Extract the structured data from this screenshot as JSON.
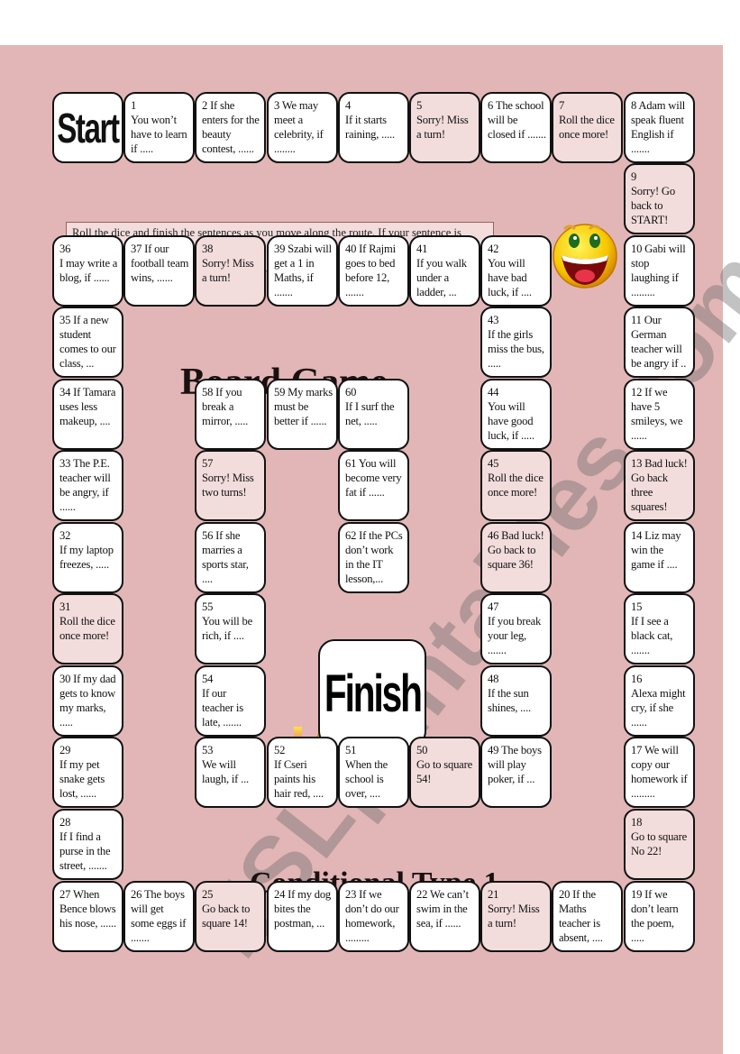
{
  "titles": {
    "board_game": "Board Game",
    "conditional": "Conditional Type 1"
  },
  "instructions": "Roll the dice and finish the sentences as you move along the route. If your sentence is incorrect, you can’t go forward. If you don’t even have a try to finish it, you must miss a turn.",
  "start_label": "Start",
  "finish_label": "Finish",
  "watermark": "ESLprintables.com",
  "colors": {
    "board_background": "#e2b6b6",
    "square_white": "#ffffff",
    "square_pink": "#f2dcdc",
    "border": "#111111"
  },
  "squares": [
    {
      "n": "1",
      "text": "You won’t have to learn if .....",
      "pink": false,
      "num_inline": false
    },
    {
      "n": "2",
      "text": "If she enters for the beauty contest, ......",
      "pink": false,
      "num_inline": true
    },
    {
      "n": "3",
      "text": "We may meet a celebrity, if ........",
      "pink": false,
      "num_inline": true
    },
    {
      "n": "4",
      "text": "If it starts raining, .....",
      "pink": false,
      "num_inline": false
    },
    {
      "n": "5",
      "text": "Sorry! Miss a turn!",
      "pink": true,
      "num_inline": false
    },
    {
      "n": "6",
      "text": "The school will be closed if .......",
      "pink": false,
      "num_inline": true
    },
    {
      "n": "7",
      "text": "Roll the dice once more!",
      "pink": true,
      "num_inline": false
    },
    {
      "n": "8",
      "text": "Adam will speak fluent English if .......",
      "pink": false,
      "num_inline": true
    },
    {
      "n": "9",
      "text": "Sorry! Go back to START!",
      "pink": true,
      "num_inline": false
    },
    {
      "n": "10",
      "text": "Gabi will stop laughing if .........",
      "pink": false,
      "num_inline": true
    },
    {
      "n": "11",
      "text": "Our German teacher will be angry if ..",
      "pink": false,
      "num_inline": true
    },
    {
      "n": "12",
      "text": "If we have 5 smileys, we ......",
      "pink": false,
      "num_inline": true
    },
    {
      "n": "13",
      "text": "Bad luck! Go back three squares!",
      "pink": true,
      "num_inline": true
    },
    {
      "n": "14",
      "text": "Liz may win the game if ....",
      "pink": false,
      "num_inline": true
    },
    {
      "n": "15",
      "text": "If I see a black cat, .......",
      "pink": false,
      "num_inline": false
    },
    {
      "n": "16",
      "text": "Alexa might cry, if she ......",
      "pink": false,
      "num_inline": false
    },
    {
      "n": "17",
      "text": "We will copy our homework if .........",
      "pink": false,
      "num_inline": true
    },
    {
      "n": "18",
      "text": "Go to square No 22!",
      "pink": true,
      "num_inline": false
    },
    {
      "n": "19",
      "text": "If we don’t learn the poem, .....",
      "pink": false,
      "num_inline": true
    },
    {
      "n": "20",
      "text": "If the Maths teacher is absent, ....",
      "pink": false,
      "num_inline": true
    },
    {
      "n": "21",
      "text": "Sorry! Miss a turn!",
      "pink": true,
      "num_inline": false
    },
    {
      "n": "22",
      "text": "We can’t swim in the sea, if ......",
      "pink": false,
      "num_inline": true
    },
    {
      "n": "23",
      "text": "If we don’t do our homework, .........",
      "pink": false,
      "num_inline": true
    },
    {
      "n": "24",
      "text": "If my dog bites the postman, ...",
      "pink": false,
      "num_inline": true
    },
    {
      "n": "25",
      "text": "Go back to square 14!",
      "pink": true,
      "num_inline": false
    },
    {
      "n": "26",
      "text": "The boys will get some eggs if .......",
      "pink": false,
      "num_inline": true
    },
    {
      "n": "27",
      "text": "When Bence blows his nose, ......",
      "pink": false,
      "num_inline": true
    },
    {
      "n": "28",
      "text": "If I find a purse in the street, .......",
      "pink": false,
      "num_inline": false
    },
    {
      "n": "29",
      "text": "If my pet snake gets lost, ......",
      "pink": false,
      "num_inline": false
    },
    {
      "n": "30",
      "text": "If my dad gets to know my marks, .....",
      "pink": false,
      "num_inline": true
    },
    {
      "n": "31",
      "text": "Roll the dice once more!",
      "pink": true,
      "num_inline": false
    },
    {
      "n": "32",
      "text": "If my laptop freezes, .....",
      "pink": false,
      "num_inline": false
    },
    {
      "n": "33",
      "text": "The P.E. teacher will be angry, if ......",
      "pink": false,
      "num_inline": true
    },
    {
      "n": "34",
      "text": "If Tamara uses less makeup, ....",
      "pink": false,
      "num_inline": true
    },
    {
      "n": "35",
      "text": "If a new student comes to our class, ...",
      "pink": false,
      "num_inline": true
    },
    {
      "n": "36",
      "text": "I may write a blog, if ......",
      "pink": false,
      "num_inline": false
    },
    {
      "n": "37",
      "text": "If our football team wins, ......",
      "pink": false,
      "num_inline": true
    },
    {
      "n": "38",
      "text": "Sorry! Miss a turn!",
      "pink": true,
      "num_inline": false
    },
    {
      "n": "39",
      "text": "Szabi will get a 1 in Maths, if .......",
      "pink": false,
      "num_inline": true
    },
    {
      "n": "40",
      "text": "If Rajmi goes to bed before 12, .......",
      "pink": false,
      "num_inline": true
    },
    {
      "n": "41",
      "text": "If you walk under a ladder, ...",
      "pink": false,
      "num_inline": false
    },
    {
      "n": "42",
      "text": "You will have bad luck, if ....",
      "pink": false,
      "num_inline": false
    },
    {
      "n": "43",
      "text": "If the girls miss the bus, .....",
      "pink": false,
      "num_inline": false
    },
    {
      "n": "44",
      "text": "You will have good luck, if .....",
      "pink": false,
      "num_inline": false
    },
    {
      "n": "45",
      "text": "Roll the dice once more!",
      "pink": true,
      "num_inline": false
    },
    {
      "n": "46",
      "text": "Bad luck! Go back to square 36!",
      "pink": true,
      "num_inline": true
    },
    {
      "n": "47",
      "text": "If you break your leg, .......",
      "pink": false,
      "num_inline": false
    },
    {
      "n": "48",
      "text": "If the sun shines, ....",
      "pink": false,
      "num_inline": false
    },
    {
      "n": "49",
      "text": "The boys will play poker, if ...",
      "pink": false,
      "num_inline": true
    },
    {
      "n": "50",
      "text": "Go to square 54!",
      "pink": true,
      "num_inline": false
    },
    {
      "n": "51",
      "text": "When the school is over, ....",
      "pink": false,
      "num_inline": false
    },
    {
      "n": "52",
      "text": "If Cseri paints his hair red, ....",
      "pink": false,
      "num_inline": false
    },
    {
      "n": "53",
      "text": "We will laugh, if ...",
      "pink": false,
      "num_inline": false
    },
    {
      "n": "54",
      "text": "If our teacher is late, .......",
      "pink": false,
      "num_inline": false
    },
    {
      "n": "55",
      "text": "You will be rich, if ....",
      "pink": false,
      "num_inline": false
    },
    {
      "n": "56",
      "text": "If she marries a sports star, ....",
      "pink": false,
      "num_inline": true
    },
    {
      "n": "57",
      "text": "Sorry! Miss two turns!",
      "pink": true,
      "num_inline": false
    },
    {
      "n": "58",
      "text": "If you break a mirror, .....",
      "pink": false,
      "num_inline": true
    },
    {
      "n": "59",
      "text": "My marks must be better if ......",
      "pink": false,
      "num_inline": true
    },
    {
      "n": "60",
      "text": "If I surf the net, .....",
      "pink": false,
      "num_inline": false
    },
    {
      "n": "61",
      "text": "You will become very fat if ......",
      "pink": false,
      "num_inline": true
    },
    {
      "n": "62",
      "text": "If the PCs don’t work in the IT lesson,...",
      "pink": false,
      "num_inline": true
    }
  ]
}
